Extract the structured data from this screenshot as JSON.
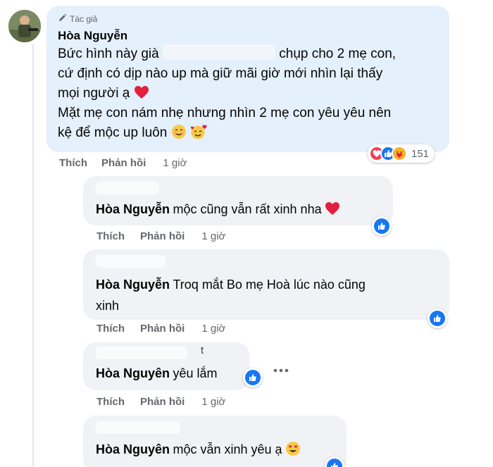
{
  "main_comment": {
    "badge": "Tác giả",
    "author": "Hòa Nguyễn",
    "line1_before": "Bức hình này già",
    "line1_after": "chụp cho 2 mẹ con,",
    "line2": "cứ định có dịp nào up mà giữ mãi giờ mới nhìn lại thấy",
    "line3": "mọi người ạ",
    "line4": "Mặt mẹ con nám nhẹ nhưng nhìn 2 mẹ con yêu yêu nên",
    "line5": "kệ để mộc up luôn",
    "reaction_count": "151",
    "actions": {
      "like": "Thích",
      "reply": "Phản hồi",
      "time": "1 giờ"
    }
  },
  "replies": [
    {
      "author": "Hòa Nguyễn",
      "text": "mộc cũng vẫn rất xinh nha",
      "actions": {
        "like": "Thích",
        "reply": "Phản hồi",
        "time": "1 giờ"
      }
    },
    {
      "author": "Hòa Nguyễn",
      "text_line1": "Troq mắt Bo mẹ Hoà lúc nào cũng",
      "text_line2": "xinh",
      "actions": {
        "like": "Thích",
        "reply": "Phản hồi",
        "time": "1 giờ"
      }
    },
    {
      "header_fragment": "t",
      "author": "Hòa Nguyên",
      "text": "yêu lắm",
      "actions": {
        "like": "Thích",
        "reply": "Phản hồi",
        "time": "1 giờ"
      }
    },
    {
      "author": "Hòa Nguyên",
      "text": "mộc vẫn xinh yêu ạ"
    }
  ],
  "colors": {
    "main_bubble": "#e4f0fb",
    "reply_bubble": "#f0f2f5",
    "like_blue": "#1877f2",
    "love_red": "#f33e58",
    "heart_red": "#e41e3f"
  },
  "icons": {
    "author_badge": "pencil-icon",
    "more": "more-dots-icon",
    "reactions": [
      "love-icon",
      "like-icon",
      "care-icon"
    ]
  }
}
